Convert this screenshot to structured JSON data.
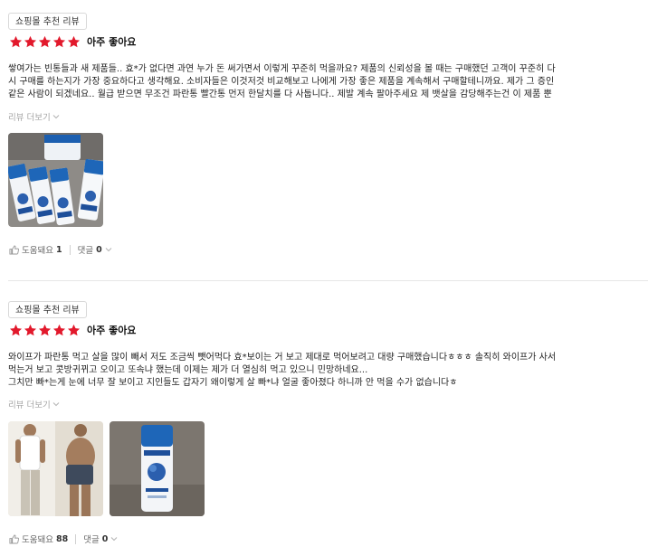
{
  "reviews": [
    {
      "badge": "쇼핑몰 추천 리뷰",
      "stars": 5,
      "rating_text": "아주 좋아요",
      "body": "쌓여가는 빈통들과 새 제품들.. 효*가 없다면 과연 누가 돈 써가면서 이렇게 꾸준히 먹을까요? 제품의 신뢰성을 볼 때는 구매했던 고객이 꾸준히 다\n시 구매를 하는지가 가장 중요하다고 생각해요. 소비자들은 이것저것 비교해보고 나에게 가장 좋은 제품을 계속해서 구매할테니까요. 제가 그 증인\n같은 사람이 되겠네요.. 월급 받으면 무조건 파란통 빨간통 먼저 한달치를 다 사둡니다.. 제발 계속 팔아주세요 제 뱃살을 감당해주는건 이 제품 뿐",
      "more": "리뷰 더보기",
      "helpful_label": "도움돼요",
      "helpful_count": "1",
      "comments_label": "댓글",
      "comments_count": "0"
    },
    {
      "badge": "쇼핑몰 추천 리뷰",
      "stars": 5,
      "rating_text": "아주 좋아요",
      "body": "와이프가 파란통 먹고 살을 많이 빼서 저도 조금씩 뺏어먹다 효*보이는 거 보고 제대로 먹어보려고 대량 구매했습니다ㅎㅎㅎ 솔직히 와이프가 사서\n먹는거 보고 콧방귀뀌고 오이고 또속냐 했는데 이제는 제가 더 열심히 먹고 있으니 민망하네요...\n그치만 빠*는게 눈에 너무 잘 보이고 지인들도 갑자기 왜이렇게 살 빠*냐 얼굴 좋아졌다 하니까 안 먹을 수가 없습니다ㅎ",
      "more": "리뷰 더보기",
      "helpful_label": "도움돼요",
      "helpful_count": "88",
      "comments_label": "댓글",
      "comments_count": "0"
    }
  ],
  "colors": {
    "star": "#e2192c",
    "bottle": "#1e66b8",
    "muted": "#a5a5a5"
  },
  "icons": [
    "star-icon",
    "chevron-down-icon",
    "thumbs-up-icon"
  ]
}
